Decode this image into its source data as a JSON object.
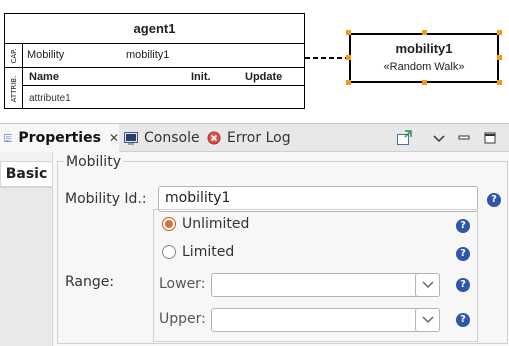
{
  "diagram": {
    "agent": {
      "title": "agent1",
      "cap_section_label": "CAP.",
      "attr_section_label": "ATTRIB.",
      "capability": {
        "key": "Mobility",
        "value": "mobility1"
      },
      "attr_headers": {
        "name": "Name",
        "init": "Init.",
        "update": "Update"
      },
      "attributes": [
        "attribute1"
      ]
    },
    "mobility": {
      "title": "mobility1",
      "stereotype": "«Random Walk»",
      "selection_color": "#f39c12"
    }
  },
  "tabs": [
    {
      "label": "Properties",
      "icon": "properties-icon",
      "active": true,
      "closable": true
    },
    {
      "label": "Console",
      "icon": "console-icon",
      "active": false
    },
    {
      "label": "Error Log",
      "icon": "error-log-icon",
      "active": false
    }
  ],
  "toolbar": {
    "icons": [
      "pin-icon",
      "view-menu-icon",
      "minimize-icon",
      "maximize-icon"
    ]
  },
  "properties": {
    "side_tab": "Basic",
    "group_title": "Mobility",
    "mobility_id_label": "Mobility Id.:",
    "mobility_id_value": "mobility1",
    "range_label": "Range:",
    "range_options": [
      {
        "label": "Unlimited",
        "checked": true
      },
      {
        "label": "Limited",
        "checked": false
      }
    ],
    "lower_label": "Lower:",
    "lower_value": "",
    "upper_label": "Upper:",
    "upper_value": "",
    "help_glyph": "?"
  },
  "colors": {
    "help_blue": "#2f56a8",
    "radio_accent": "#d4713a"
  }
}
